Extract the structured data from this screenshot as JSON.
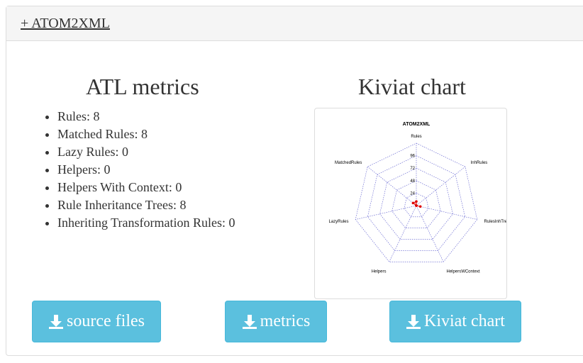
{
  "header": {
    "toggle_label": "+ ATOM2XML"
  },
  "metrics": {
    "title": "ATL metrics",
    "items": [
      "Rules: 8",
      "Matched Rules: 8",
      "Lazy Rules: 0",
      "Helpers: 0",
      "Helpers With Context: 0",
      "Rule Inheritance Trees: 8",
      "Inheriting Transformation Rules: 0"
    ]
  },
  "kiviat": {
    "title": "Kiviat chart"
  },
  "chart_data": {
    "type": "radar",
    "title": "ATOM2XML",
    "axes": [
      "Rules",
      "InhRules",
      "RulesInhTrees",
      "HelpersWContext",
      "Helpers",
      "LazyRules",
      "MatchedRules"
    ],
    "ticks": [
      "24",
      "48",
      "72",
      "96"
    ],
    "range": [
      0,
      120
    ],
    "values": [
      8,
      0,
      8,
      0,
      0,
      0,
      8
    ],
    "colors": {
      "series": "#dd0000",
      "grid": "#5555cc"
    }
  },
  "buttons": {
    "source_label": "source files",
    "metrics_label": "metrics",
    "kiviat_label": "Kiviat chart"
  },
  "icons": {
    "download": "download-icon"
  },
  "colors": {
    "button_bg": "#5bc0de",
    "button_border": "#46b8da"
  }
}
